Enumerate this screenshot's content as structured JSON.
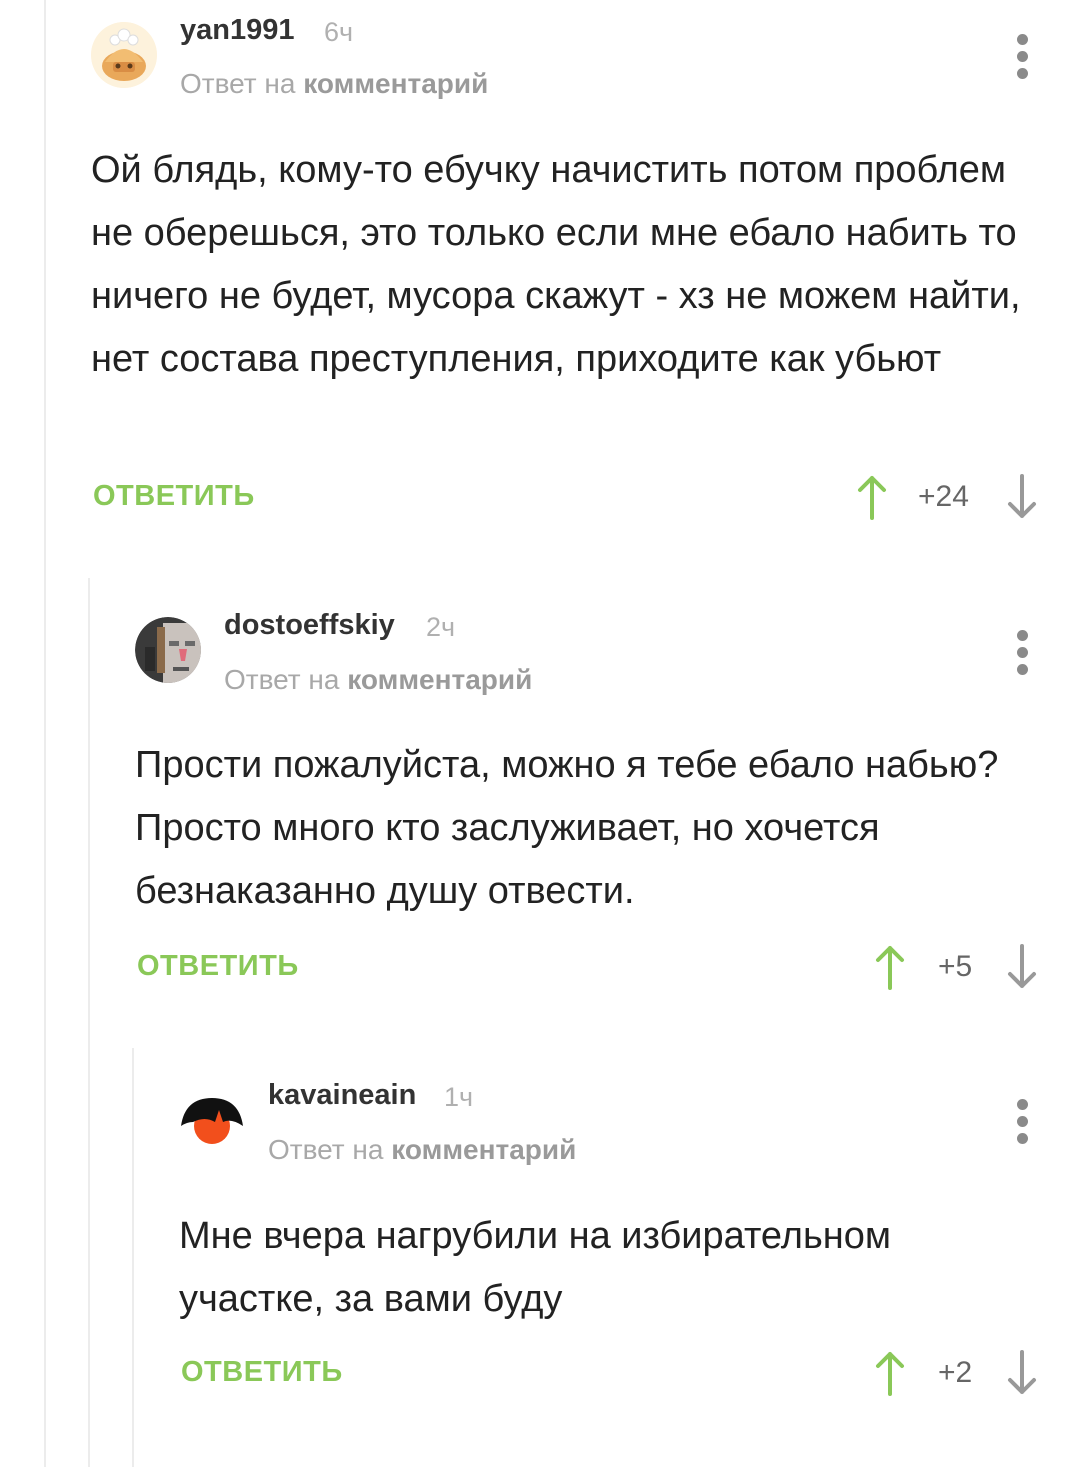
{
  "comments": [
    {
      "username": "yan1991",
      "time": "6ч",
      "reply_prefix": "Ответ на",
      "reply_link": "комментарий",
      "text": "Ой блядь, кому-то ебучку начистить потом проблем не оберешься, это только если мне ебало набить то ничего не будет, мусора скажут - хз не можем найти, нет состава преступления, приходите как убьют",
      "reply_label": "ОТВЕТИТЬ",
      "rating": "+24",
      "avatar_icon": "cat-avatar-icon"
    },
    {
      "username": "dostoeffskiy",
      "time": "2ч",
      "reply_prefix": "Ответ на",
      "reply_link": "комментарий",
      "text": "Прости пожалуйста, можно я тебе ебало набью? Просто много кто заслуживает, но хочется безнаказанно душу отвести.",
      "reply_label": "ОТВЕТИТЬ",
      "rating": "+5",
      "avatar_icon": "portrait-avatar-icon"
    },
    {
      "username": "kavaineain",
      "time": "1ч",
      "reply_prefix": "Ответ на",
      "reply_link": "комментарий",
      "text": "Мне вчера нагрубили на избирательном участке, за вами буду",
      "reply_label": "ОТВЕТИТЬ",
      "rating": "+2",
      "avatar_icon": "hair-avatar-icon"
    }
  ],
  "colors": {
    "accent_green": "#8ac858",
    "thread_line": "#ececec",
    "username": "#333333",
    "muted": "#a8a8a8"
  }
}
